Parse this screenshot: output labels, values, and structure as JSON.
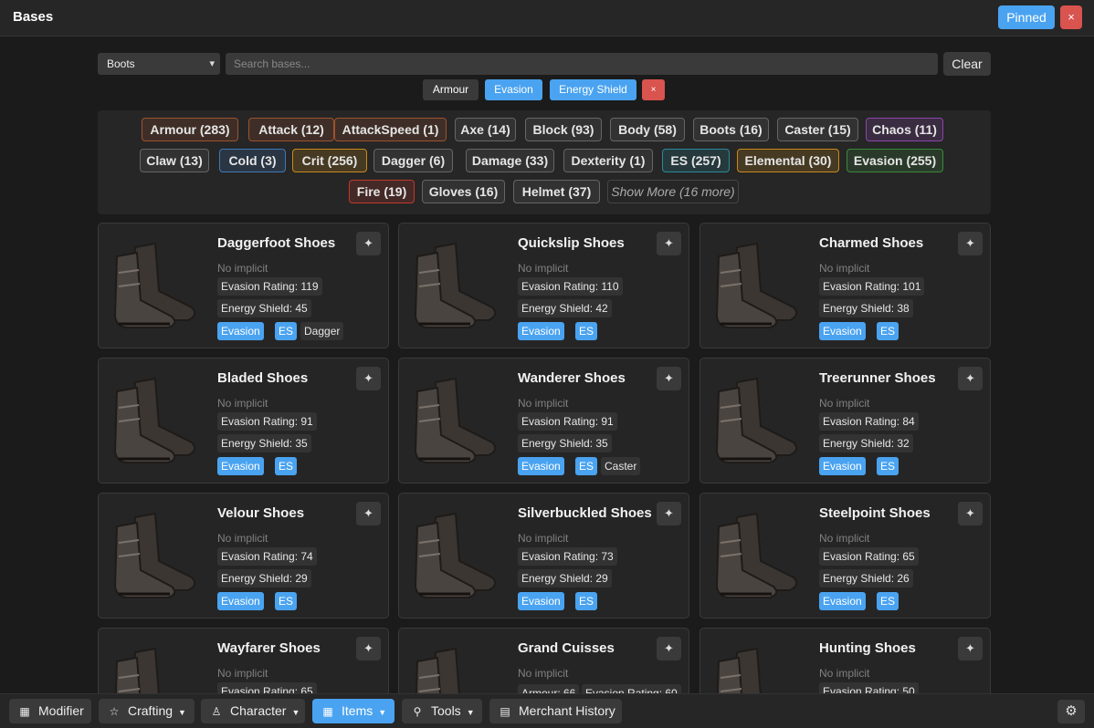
{
  "window": {
    "title": "Bases",
    "pinned_label": "Pinned",
    "close_label": "×"
  },
  "search": {
    "category_value": "Boots",
    "placeholder": "Search bases...",
    "clear_label": "Clear"
  },
  "active_filters": [
    {
      "label": "Armour",
      "style": "dark"
    },
    {
      "label": "Evasion",
      "style": "blue"
    },
    {
      "label": "Energy Shield",
      "style": "blue"
    },
    {
      "label": "×",
      "style": "red"
    }
  ],
  "tags": [
    {
      "label": "Armour (283)",
      "color": "#a0522d"
    },
    {
      "label": "Attack (12)",
      "color": "#a0522d"
    },
    {
      "label": "AttackSpeed (1)",
      "color": "#a0522d"
    },
    {
      "label": "Axe (14)",
      "color": "#666666"
    },
    {
      "label": "Block (93)",
      "color": "#666666"
    },
    {
      "label": "Body (58)",
      "color": "#666666"
    },
    {
      "label": "Boots (16)",
      "color": "#666666"
    },
    {
      "label": "Caster (15)",
      "color": "#666666"
    },
    {
      "label": "Chaos (11)",
      "color": "#8e44ad"
    },
    {
      "label": "Claw (13)",
      "color": "#666666"
    },
    {
      "label": "Cold (3)",
      "color": "#3d7ab8"
    },
    {
      "label": "Crit (256)",
      "color": "#c98a1a"
    },
    {
      "label": "Dagger (6)",
      "color": "#666666"
    },
    {
      "label": "Damage (33)",
      "color": "#666666"
    },
    {
      "label": "Dexterity (1)",
      "color": "#666666"
    },
    {
      "label": "ES (257)",
      "color": "#2a8a9a"
    },
    {
      "label": "Elemental (30)",
      "color": "#c98a1a"
    },
    {
      "label": "Evasion (255)",
      "color": "#3a8a3a"
    },
    {
      "label": "Fire (19)",
      "color": "#c0392b"
    },
    {
      "label": "Gloves (16)",
      "color": "#666666"
    },
    {
      "label": "Helmet (37)",
      "color": "#666666"
    }
  ],
  "show_more_label": "Show More (16 more)",
  "pin_icon": "sparkle-icon",
  "items": [
    {
      "name": "Daggerfoot Shoes",
      "implicit": "No implicit",
      "stats": [
        "Evasion Rating: 119",
        "Energy Shield: 45"
      ],
      "tags": [
        {
          "label": "Evasion",
          "style": "blue"
        },
        {
          "label": "ES",
          "style": "blue"
        },
        {
          "label": "Dagger",
          "style": "dark"
        }
      ]
    },
    {
      "name": "Quickslip Shoes",
      "implicit": "No implicit",
      "stats": [
        "Evasion Rating: 110",
        "Energy Shield: 42"
      ],
      "tags": [
        {
          "label": "Evasion",
          "style": "blue"
        },
        {
          "label": "ES",
          "style": "blue"
        }
      ]
    },
    {
      "name": "Charmed Shoes",
      "implicit": "No implicit",
      "stats": [
        "Evasion Rating: 101",
        "Energy Shield: 38"
      ],
      "tags": [
        {
          "label": "Evasion",
          "style": "blue"
        },
        {
          "label": "ES",
          "style": "blue"
        }
      ]
    },
    {
      "name": "Bladed Shoes",
      "implicit": "No implicit",
      "stats": [
        "Evasion Rating: 91",
        "Energy Shield: 35"
      ],
      "tags": [
        {
          "label": "Evasion",
          "style": "blue"
        },
        {
          "label": "ES",
          "style": "blue"
        }
      ]
    },
    {
      "name": "Wanderer Shoes",
      "implicit": "No implicit",
      "stats": [
        "Evasion Rating: 91",
        "Energy Shield: 35"
      ],
      "tags": [
        {
          "label": "Evasion",
          "style": "blue"
        },
        {
          "label": "ES",
          "style": "blue"
        },
        {
          "label": "Caster",
          "style": "dark"
        }
      ]
    },
    {
      "name": "Treerunner Shoes",
      "implicit": "No implicit",
      "stats": [
        "Evasion Rating: 84",
        "Energy Shield: 32"
      ],
      "tags": [
        {
          "label": "Evasion",
          "style": "blue"
        },
        {
          "label": "ES",
          "style": "blue"
        }
      ]
    },
    {
      "name": "Velour Shoes",
      "implicit": "No implicit",
      "stats": [
        "Evasion Rating: 74",
        "Energy Shield: 29"
      ],
      "tags": [
        {
          "label": "Evasion",
          "style": "blue"
        },
        {
          "label": "ES",
          "style": "blue"
        }
      ]
    },
    {
      "name": "Silverbuckled Shoes",
      "implicit": "No implicit",
      "stats": [
        "Evasion Rating: 73",
        "Energy Shield: 29"
      ],
      "tags": [
        {
          "label": "Evasion",
          "style": "blue"
        },
        {
          "label": "ES",
          "style": "blue"
        }
      ]
    },
    {
      "name": "Steelpoint Shoes",
      "implicit": "No implicit",
      "stats": [
        "Evasion Rating: 65",
        "Energy Shield: 26"
      ],
      "tags": [
        {
          "label": "Evasion",
          "style": "blue"
        },
        {
          "label": "ES",
          "style": "blue"
        }
      ]
    },
    {
      "name": "Wayfarer Shoes",
      "implicit": "No implicit",
      "stats": [
        "Evasion Rating: 65"
      ],
      "tags": []
    },
    {
      "name": "Grand Cuisses",
      "implicit": "No implicit",
      "stats": [
        "Armour: 66",
        "Evasion Rating: 60"
      ],
      "tags": []
    },
    {
      "name": "Hunting Shoes",
      "implicit": "No implicit",
      "stats": [
        "Evasion Rating: 50"
      ],
      "tags": []
    }
  ],
  "nav": [
    {
      "label": "Modifier",
      "icon": "grid-icon",
      "dropdown": false,
      "active": false
    },
    {
      "label": "Crafting",
      "icon": "star-icon",
      "dropdown": true,
      "active": false
    },
    {
      "label": "Character",
      "icon": "person-icon",
      "dropdown": true,
      "active": false
    },
    {
      "label": "Items",
      "icon": "grid-icon",
      "dropdown": true,
      "active": true
    },
    {
      "label": "Tools",
      "icon": "wrench-icon",
      "dropdown": true,
      "active": false
    },
    {
      "label": "Merchant History",
      "icon": "table-icon",
      "dropdown": false,
      "active": false
    }
  ],
  "settings_icon": "gear-icon"
}
